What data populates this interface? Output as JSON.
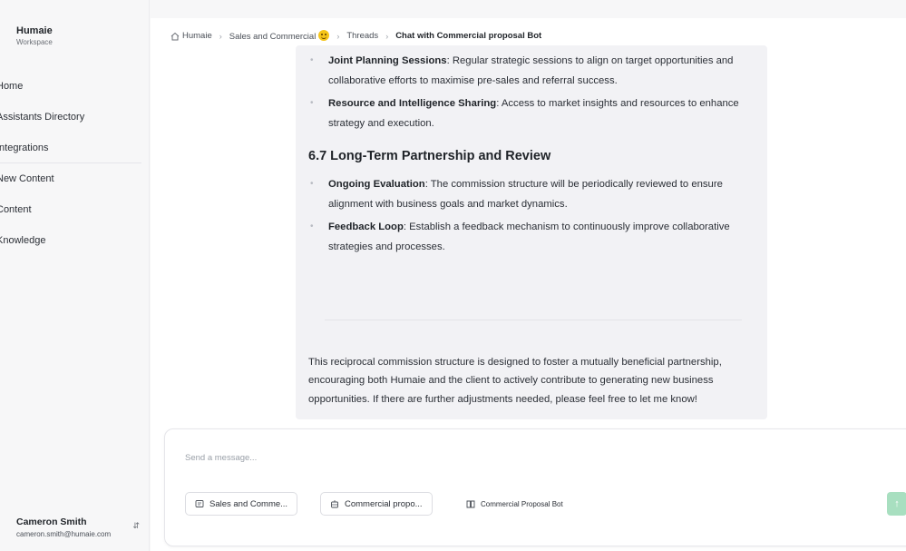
{
  "workspace": {
    "name": "Humaie",
    "subtitle": "Workspace"
  },
  "sidebar": {
    "items": [
      {
        "label": "Home"
      },
      {
        "label": "Assistants Directory"
      },
      {
        "label": "Integrations"
      },
      {
        "label": "New Content"
      },
      {
        "label": "Content"
      },
      {
        "label": "Knowledge"
      }
    ]
  },
  "user": {
    "name": "Cameron Smith",
    "email": "cameron.smith@humaie.com"
  },
  "breadcrumb": {
    "home": "Humaie",
    "section": "Sales and Commercial",
    "threads": "Threads",
    "current": "Chat with Commercial proposal Bot"
  },
  "message": {
    "bullets_top": [
      {
        "title": "Joint Planning Sessions",
        "text": ": Regular strategic sessions to align on target opportunities and collaborative efforts to maximise pre-sales and referral success."
      },
      {
        "title": "Resource and Intelligence Sharing",
        "text": ": Access to market insights and resources to enhance strategy and execution."
      }
    ],
    "heading": "6.7 Long-Term Partnership and Review",
    "bullets_bottom": [
      {
        "title": "Ongoing Evaluation",
        "text": ": The commission structure will be periodically reviewed to ensure alignment with business goals and market dynamics."
      },
      {
        "title": "Feedback Loop",
        "text": ": Establish a feedback mechanism to continuously improve collaborative strategies and processes."
      }
    ],
    "closing": "This reciprocal commission structure is designed to foster a mutually beneficial partnership, encouraging both Humaie and the client to actively contribute to generating new business opportunities. If there are further adjustments needed, please feel free to let me know!"
  },
  "composer": {
    "placeholder": "Send a message...",
    "chips": [
      {
        "label": "Sales and Comme...",
        "icon": "folder-icon"
      },
      {
        "label": "Commercial propo...",
        "icon": "bot-icon"
      },
      {
        "label": "Commercial Proposal Bot",
        "icon": "book-icon"
      }
    ],
    "send_icon": "arrow-up-icon"
  },
  "colors": {
    "accent": "#a8dfc0",
    "bubble": "#f2f2f5"
  }
}
